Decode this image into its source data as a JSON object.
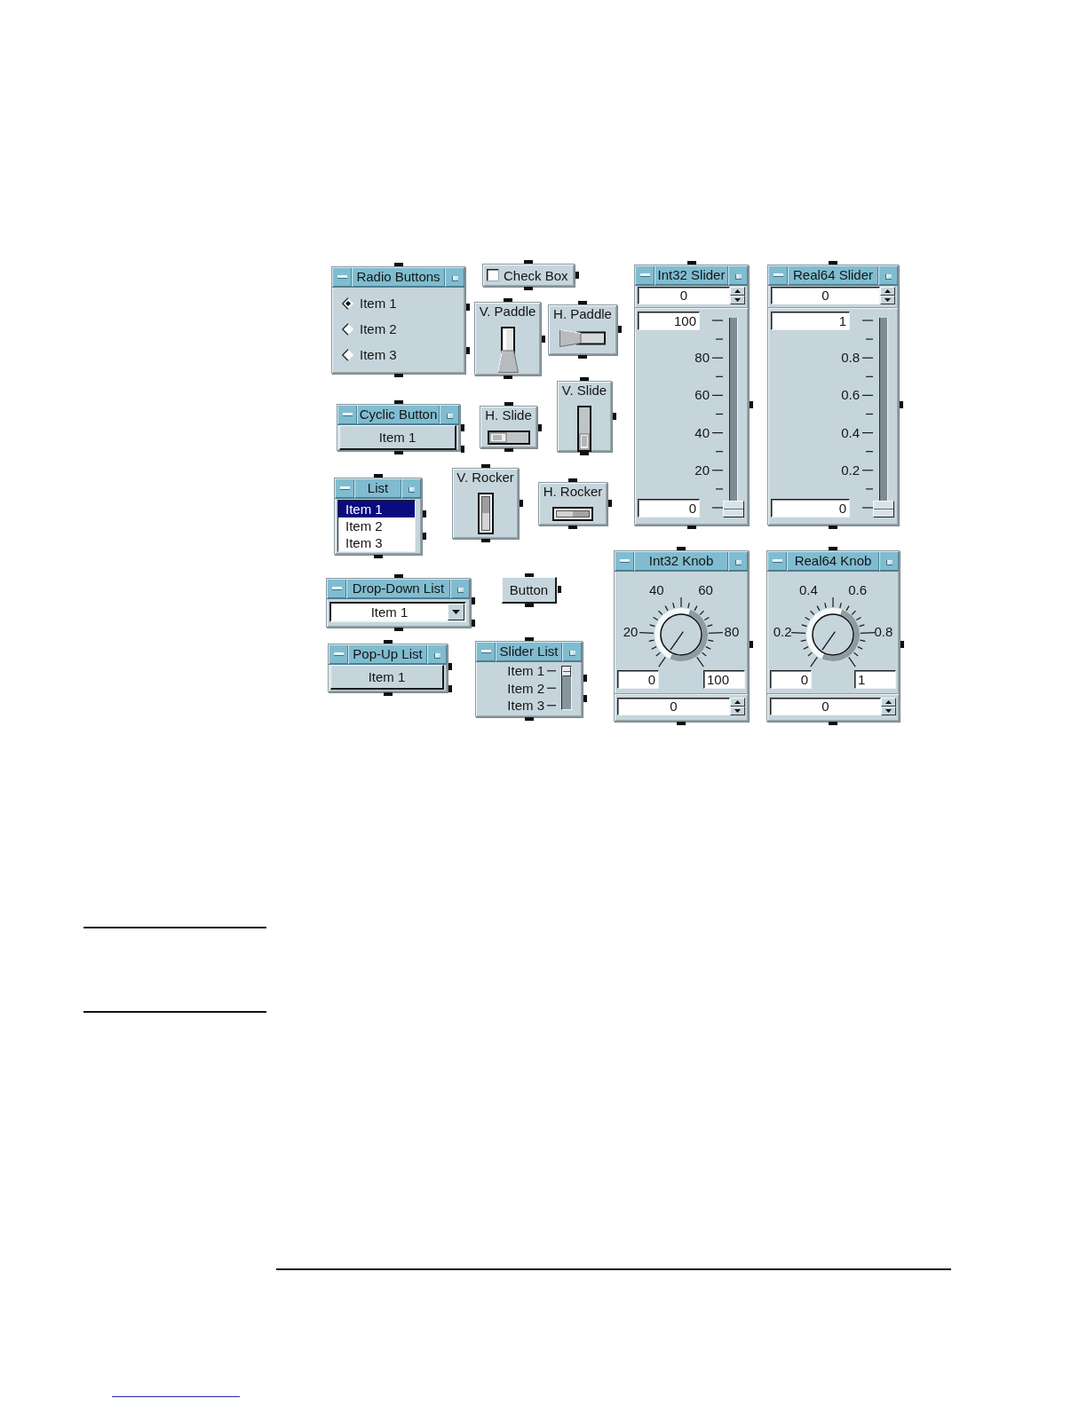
{
  "workspace": {
    "objects": [
      {
        "kind": "radio_buttons",
        "title": "Radio Buttons",
        "items": [
          {
            "label": "Item 1",
            "selected": true
          },
          {
            "label": "Item 2",
            "selected": false
          },
          {
            "label": "Item 3",
            "selected": false
          }
        ]
      },
      {
        "kind": "check_box",
        "label": "Check Box",
        "checked": false
      },
      {
        "kind": "paddle_vertical",
        "label": "V. Paddle",
        "on": false
      },
      {
        "kind": "paddle_horizontal",
        "label": "H. Paddle",
        "on": false
      },
      {
        "kind": "slider",
        "title": "Int32 Slider",
        "value": "0",
        "max": "100",
        "min": "0",
        "scale_labels": [
          "80",
          "60",
          "40",
          "20"
        ],
        "level": 0
      },
      {
        "kind": "slider",
        "title": "Real64 Slider",
        "value": "0",
        "max": "1",
        "min": "0",
        "scale_labels": [
          "0.8",
          "0.6",
          "0.4",
          "0.2"
        ],
        "level": 0
      },
      {
        "kind": "cyclic_button",
        "title": "Cyclic Button",
        "value": "Item 1"
      },
      {
        "kind": "slide_horizontal",
        "label": "H. Slide",
        "on": false
      },
      {
        "kind": "slide_vertical",
        "label": "V. Slide",
        "on": false
      },
      {
        "kind": "list",
        "title": "List",
        "items": [
          {
            "label": "Item 1",
            "selected": true
          },
          {
            "label": "Item 2",
            "selected": false
          },
          {
            "label": "Item 3",
            "selected": false
          }
        ]
      },
      {
        "kind": "rocker_vertical",
        "label": "V. Rocker",
        "on": false
      },
      {
        "kind": "rocker_horizontal",
        "label": "H. Rocker",
        "on": false
      },
      {
        "kind": "drop_down_list",
        "title": "Drop-Down List",
        "value": "Item 1"
      },
      {
        "kind": "button",
        "label": "Button"
      },
      {
        "kind": "knob",
        "title": "Int32 Knob",
        "scale_labels": [
          "20",
          "40",
          "60",
          "80"
        ],
        "min": "0",
        "max": "100",
        "value": "0"
      },
      {
        "kind": "knob",
        "title": "Real64 Knob",
        "scale_labels": [
          "0.2",
          "0.4",
          "0.6",
          "0.8"
        ],
        "min": "0",
        "max": "1",
        "value": "0"
      },
      {
        "kind": "pop_up_list",
        "title": "Pop-Up List",
        "value": "Item 1"
      },
      {
        "kind": "slider_list",
        "title": "Slider List",
        "items": [
          {
            "label": "Item 1",
            "selected": true
          },
          {
            "label": "Item 2",
            "selected": false
          },
          {
            "label": "Item 3",
            "selected": false
          }
        ]
      }
    ]
  }
}
